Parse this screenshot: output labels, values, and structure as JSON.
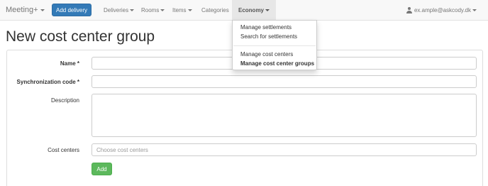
{
  "navbar": {
    "brand": "Meeting+",
    "add_delivery": "Add delivery",
    "items": [
      {
        "label": "Deliveries"
      },
      {
        "label": "Rooms"
      },
      {
        "label": "Items"
      },
      {
        "label": "Categories"
      },
      {
        "label": "Economy"
      }
    ],
    "active_item": "Economy",
    "user_email": "ex.ample@askcody.dk"
  },
  "dropdown": {
    "items": [
      {
        "label": "Manage settlements"
      },
      {
        "label": "Search for settlements"
      },
      {
        "label": "Manage cost centers"
      },
      {
        "label": "Manage cost center groups",
        "active": true
      }
    ]
  },
  "page": {
    "title": "New cost center group"
  },
  "form": {
    "name_label": "Name *",
    "name_value": "",
    "sync_label": "Synchronization code *",
    "sync_value": "",
    "description_label": "Description",
    "description_value": "",
    "cost_centers_label": "Cost centers",
    "cost_centers_placeholder": "Choose cost centers",
    "add_button": "Add"
  },
  "colors": {
    "primary": "#337ab7",
    "success": "#5cb85c",
    "navbar_bg": "#f8f8f8",
    "active_nav_bg": "#e7e7e7"
  }
}
